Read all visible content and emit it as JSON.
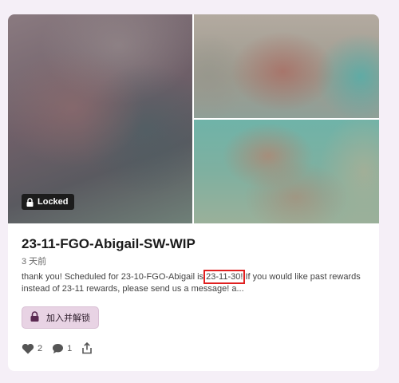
{
  "post": {
    "locked_label": "Locked",
    "title": "23-11-FGO-Abigail-SW-WIP",
    "date": "3 天前",
    "description_before": "thank you! Scheduled for 23-10-FGO-Abigail is ",
    "description_highlight": "23-11-30!",
    "description_after": " If you would like past rewards instead of 23-11 rewards, please send us a message! a...",
    "unlock_button_label": "加入并解锁",
    "likes_count": "2",
    "comments_count": "1"
  },
  "colors": {
    "background": "#f5eff7",
    "unlock_button_bg": "#e8d3e4",
    "highlight_box": "#e02020"
  }
}
